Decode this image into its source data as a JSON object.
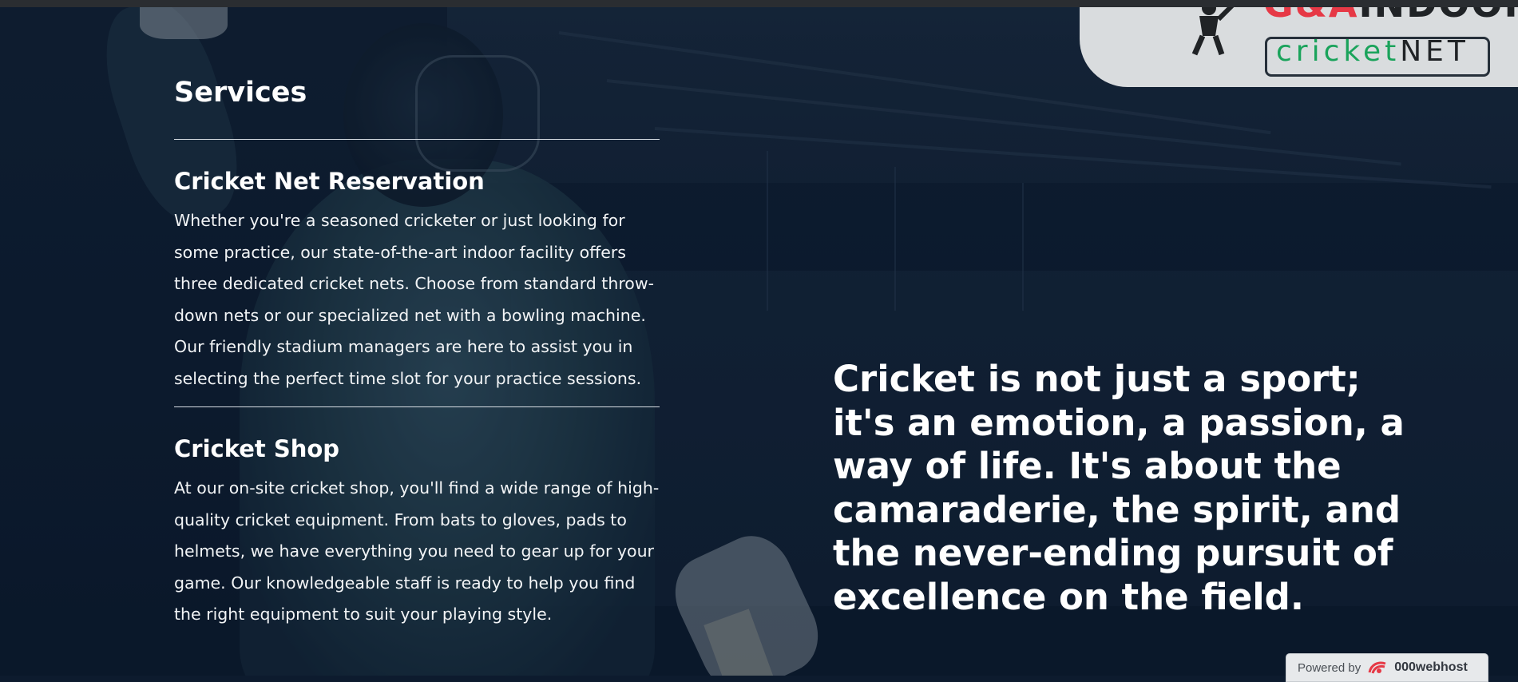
{
  "logo": {
    "top_word": "INDOOR",
    "top_prefix": "G&A",
    "bottom_word": "cricket",
    "bottom_net": "NET"
  },
  "services": {
    "heading": "Services",
    "items": [
      {
        "title": "Cricket Net Reservation",
        "text": "Whether you're a seasoned cricketer or just looking for some practice, our state-of-the-art indoor facility offers three dedicated cricket nets. Choose from standard throw-down nets or our specialized net with a bowling machine. Our friendly stadium managers are here to assist you in selecting the perfect time slot for your practice sessions."
      },
      {
        "title": "Cricket Shop",
        "text": "At our on-site cricket shop, you'll find a wide range of high-quality cricket equipment. From bats to gloves, pads to helmets, we have everything you need to gear up for your game. Our knowledgeable staff is ready to help you find the right equipment to suit your playing style."
      }
    ]
  },
  "quote": "Cricket is not just a sport; it's an emotion, a passion, a way of life. It's about the camaraderie, the spirit, and the never-ending pursuit of excellence on the field.",
  "powered_by": {
    "label": "Powered by",
    "brand": "000webhost"
  },
  "colors": {
    "background": "#0d1b2e",
    "text": "#ffffff",
    "logo_accent_red": "#e63946",
    "logo_accent_green": "#1aa35b"
  }
}
